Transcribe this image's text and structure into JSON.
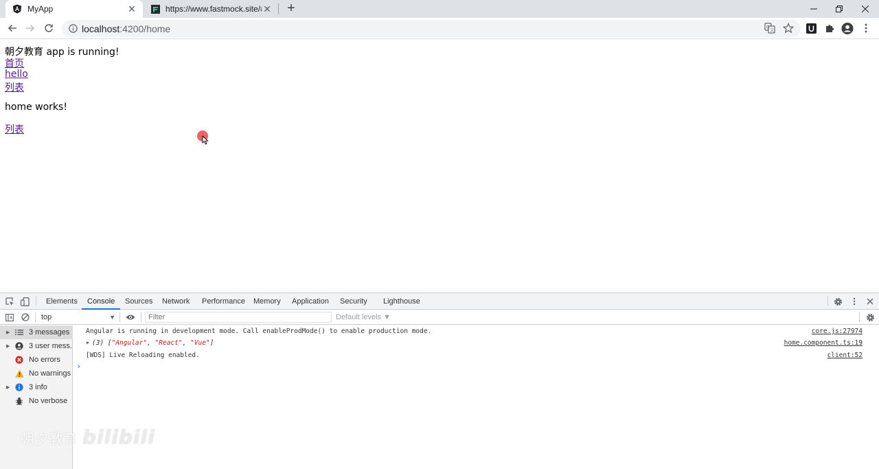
{
  "browser": {
    "tabs": [
      {
        "title": "MyApp",
        "favicon": "angular-icon",
        "active": true
      },
      {
        "title": "https://www.fastmock.site/#/p",
        "favicon": "fastmock-icon",
        "active": false
      }
    ],
    "address_host": "localhost",
    "address_path": ":4200/home"
  },
  "page": {
    "heading": "朝夕教育 app is running!",
    "links": [
      "首页",
      "hello",
      "列表"
    ],
    "home_text": "home works!",
    "bottom_link": "列表"
  },
  "devtools": {
    "tabs": [
      "Elements",
      "Console",
      "Sources",
      "Network",
      "Performance",
      "Memory",
      "Application",
      "Security",
      "Lighthouse"
    ],
    "selected_tab": "Console",
    "context": "top",
    "filter_placeholder": "Filter",
    "levels": "Default levels ▼",
    "sidebar": [
      {
        "label": "3 messages",
        "icon": "list-icon",
        "expandable": true,
        "selected": true
      },
      {
        "label": "3 user mess...",
        "icon": "user-icon",
        "expandable": true,
        "selected": false
      },
      {
        "label": "No errors",
        "icon": "error-icon",
        "expandable": false,
        "selected": false
      },
      {
        "label": "No warnings",
        "icon": "warning-icon",
        "expandable": false,
        "selected": false
      },
      {
        "label": "3 info",
        "icon": "info-icon",
        "expandable": true,
        "selected": false
      },
      {
        "label": "No verbose",
        "icon": "bug-icon",
        "expandable": false,
        "selected": false
      }
    ],
    "messages": [
      {
        "text": "Angular is running in development mode. Call enableProdMode() to enable production mode.",
        "source": "core.js:27974"
      },
      {
        "array_prefix": "(3) [",
        "items": [
          "\"Angular\"",
          "\"React\"",
          "\"Vue\""
        ],
        "array_suffix": "]",
        "source": "home.component.ts:19"
      },
      {
        "text": "[WDS] Live Reloading enabled.",
        "source": "client:52"
      }
    ]
  },
  "watermark": {
    "text": "朝夕教育",
    "logo": "bilibili"
  },
  "colors": {
    "link_visited": "#551a8b",
    "devtools_accent": "#1a73e8",
    "tabstrip": "#dee1e6",
    "cursor_highlight": "#f04646"
  }
}
